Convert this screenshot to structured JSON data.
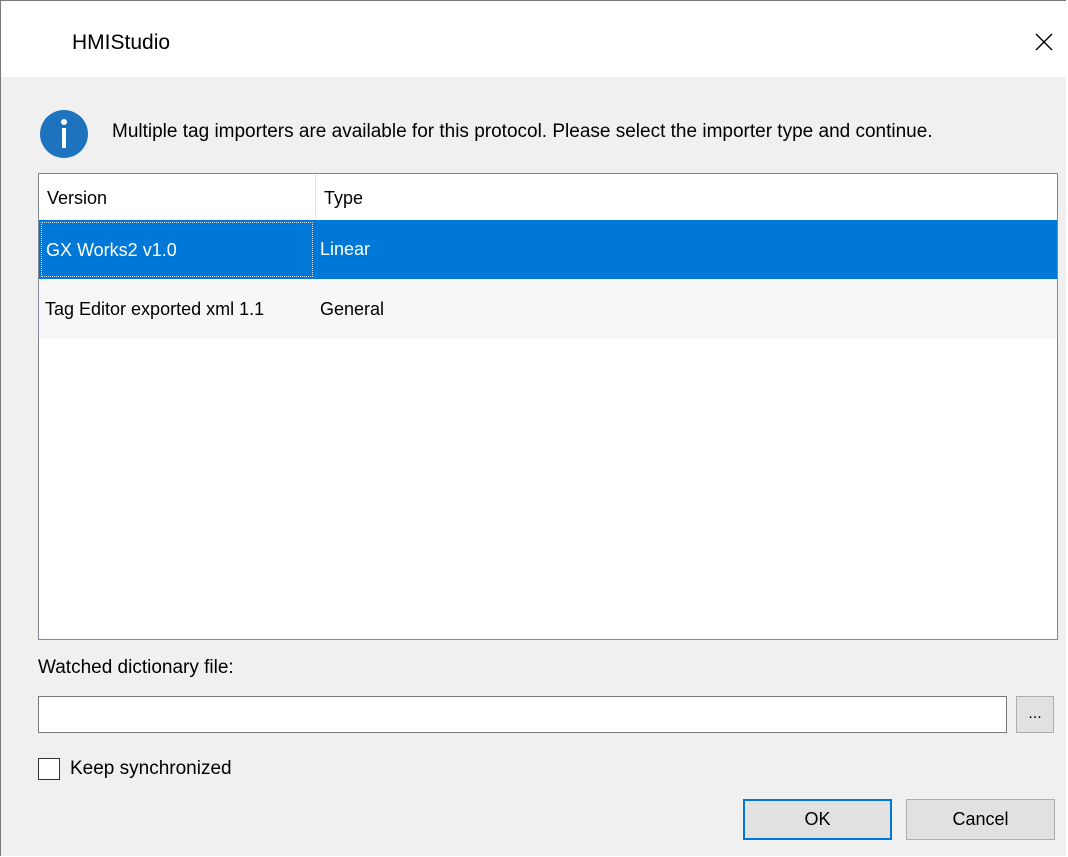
{
  "window": {
    "title": "HMIStudio",
    "close_icon": "close-icon"
  },
  "message": {
    "icon": "info-icon",
    "icon_color": "#1e73be",
    "text": "Multiple tag importers are available for this protocol. Please select the importer type and continue."
  },
  "importers": {
    "columns": [
      "Version",
      "Type"
    ],
    "rows": [
      {
        "version": "GX Works2 v1.0",
        "type": "Linear",
        "selected": true
      },
      {
        "version": "Tag Editor exported xml 1.1",
        "type": "General",
        "selected": false
      }
    ]
  },
  "watched_file": {
    "label": "Watched dictionary file:",
    "value": "",
    "browse_label": "..."
  },
  "sync": {
    "label": "Keep synchronized",
    "checked": false
  },
  "buttons": {
    "ok": "OK",
    "cancel": "Cancel"
  },
  "colors": {
    "selection": "#0078d7",
    "dialog_bg": "#f0f0f0"
  }
}
